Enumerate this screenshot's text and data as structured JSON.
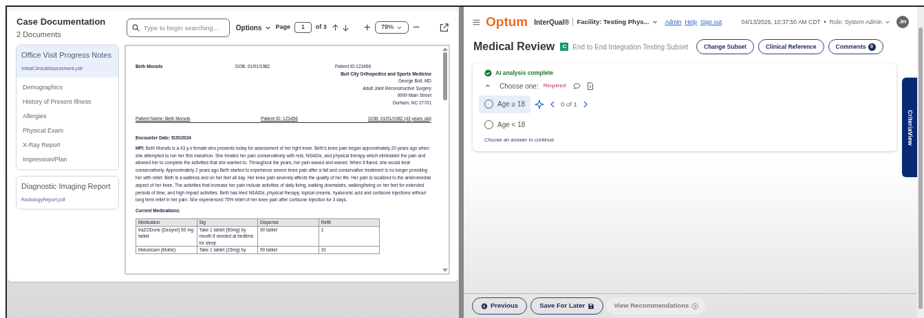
{
  "left_panel": {
    "title": "Case Documentation",
    "subtitle": "2 Documents",
    "search": {
      "placeholder": "Type to begin searching..."
    },
    "toolbar": {
      "options": "Options",
      "page_label": "Page",
      "page": "1",
      "page_of": "of 3",
      "zoom": "79%",
      "zoom_in": "+",
      "zoom_out": "−"
    },
    "documents": [
      {
        "title": "Office Visit Progress Notes",
        "file": "InitialClinicalAssessment.pdf",
        "selected": true,
        "sections": [
          "Demographics",
          "History of Present Illness",
          "Allergies",
          "Physical Exam",
          "X-Ray Report",
          "Impression/Plan"
        ]
      },
      {
        "title": "Diagnostic Imaging Report",
        "file": "RadiologyReport.pdf",
        "selected": false
      }
    ],
    "page": {
      "patient": "Beth Monuts",
      "dob": "DOB: 01/01/1982",
      "patient_id": "Patient ID:123456",
      "practice_lines": [
        "Bull City Orthopedics and Sports Medicine",
        "George Bull, MD",
        "Adult Joint Reconstructive Surgery",
        "9999 Main Street",
        "Durham, NC 27701"
      ],
      "id_line": [
        "Patient Name: Beth Monuts",
        "Patient ID: 123456",
        "DOB: 01/01/1982 (43 years old)"
      ],
      "encounter": "Encounter Date: 5/20/2024",
      "hpi": "**HPI:** Beth Monuts is a 43 y.o female who presents today for assessment of her right knee. Beth's knee pain began approximately 20 years ago when she attempted to run her first marathon. She treated her pain conservatively with rest, NSAIDs, and physical therapy which eliminated the pain and allowed her to complete the activities that she wanted to. Throughout the years, her pain waxed and waned. When it flared, she would treat conservatively. Approximately 2 years ago Beth started to experience severe knee pain after a fall and conservative treatment is no longer providing her with relief. Beth is a waitress and on her feet all day. Her knee pain severely affects the quality of her life. Her pain is localized to the anteromedial aspect of her knee. The activities that increase her pain include activities of daily living, walking downstairs, walking/being on her feet for extended periods of time, and high impact activities. Beth has tried NSAIDs, physical therapy, topical creams, hyaluronic acid and cortisone injections without long term relief in her pain. She experienced 75% relief of her knee pain after cortisone injection for 3 days.",
      "meds_title": "Current Medications:",
      "meds_table": {
        "columns": [
          "Medication",
          "Sig",
          "Dispense",
          "Refill"
        ],
        "rows": [
          [
            "traZODone (Desyrel) 50 mg tablet",
            "Take 1 tablet (50mg) by mouth if needed at bedtime for sleep",
            "90 tablet",
            "1"
          ],
          [
            "Meloxicam (Mobic)",
            "Take 1 tablet (15mg) by",
            "90 tablet",
            "10"
          ]
        ]
      }
    }
  },
  "right_panel": {
    "header": {
      "brand": "Optum",
      "product": "InterQual®",
      "facility": "Facility: Testing Phys...",
      "links": [
        "Admin",
        "Help",
        "Sign out"
      ],
      "datetime": "04/13/2026, 10:37:50 AM CDT",
      "separator": "•",
      "role": "Role: System Admin",
      "avatar": "JH"
    },
    "review": {
      "title": "Medical Review",
      "badge": "C",
      "subset": "End to End Integration Testing Subset",
      "buttons": [
        {
          "label": "Change Subset"
        },
        {
          "label": "Clinical Reference"
        },
        {
          "label": "Comments",
          "count": "0"
        }
      ]
    },
    "question": {
      "status": "AI analysis complete",
      "expanded": true,
      "prompt": "Choose one:",
      "required": "Required",
      "options": [
        {
          "label": "Age ≥ 18",
          "selected": false,
          "highlighted": true,
          "evidence": "0 of 1"
        },
        {
          "label": "Age < 18",
          "selected": false,
          "highlighted": false
        }
      ],
      "hint": "Choose an answer to continue"
    },
    "side_tab": "CriteriaView",
    "footer": [
      {
        "label": "Previous",
        "kind": "previous",
        "disabled": false
      },
      {
        "label": "Save For Later",
        "kind": "save",
        "disabled": false
      },
      {
        "label": "View Recommendations",
        "kind": "next",
        "disabled": true
      }
    ]
  }
}
